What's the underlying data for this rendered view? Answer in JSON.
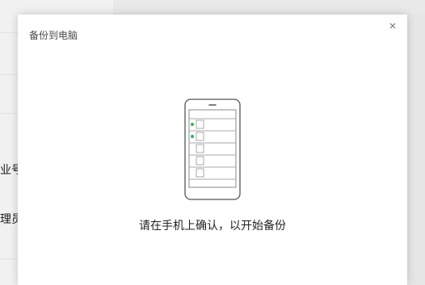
{
  "background": {
    "partial_labels": [
      "业号",
      "理员"
    ]
  },
  "dialog": {
    "title": "备份到电脑",
    "close_label": "×",
    "message": "请在手机上确认，以开始备份",
    "illustration": {
      "icon": "phone-checklist-icon",
      "accent_color": "#36b24c",
      "checked_rows": 2,
      "total_rows": 6
    }
  }
}
